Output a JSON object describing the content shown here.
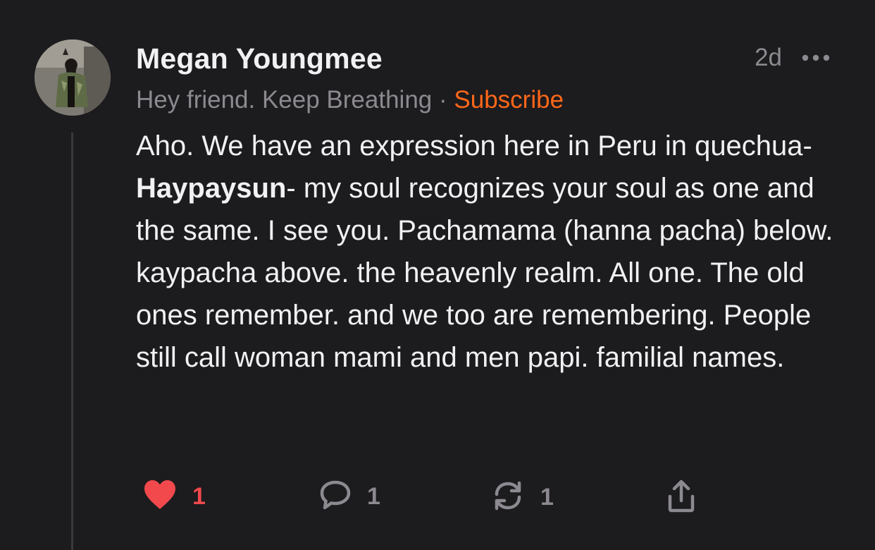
{
  "comment": {
    "author": "Megan Youngmee",
    "timestamp": "2d",
    "bio": "Hey friend. Keep Breathing",
    "separator": "·",
    "subscribe_label": "Subscribe",
    "body": {
      "part1": "Aho. We have an expression here in Peru in quechua- ",
      "bold": "Haypaysun",
      "part2": "- my soul recognizes your soul as one and the same. I see you. Pachamama (hanna pacha) below. kaypacha above. the heavenly realm. All one.  The old ones remember. and we too are remembering. People still call woman mami and men papi. familial names."
    },
    "actions": {
      "like_count": "1",
      "reply_count": "1",
      "restack_count": "1"
    },
    "icons": {
      "like": "heart-icon",
      "reply": "speech-bubble-icon",
      "restack": "restack-arrows-icon",
      "share": "share-icon",
      "more": "ellipsis-icon"
    },
    "colors": {
      "background": "#1c1b1d",
      "accent": "#ff6719",
      "liked": "#f2494d",
      "muted": "#8c8a90"
    }
  }
}
